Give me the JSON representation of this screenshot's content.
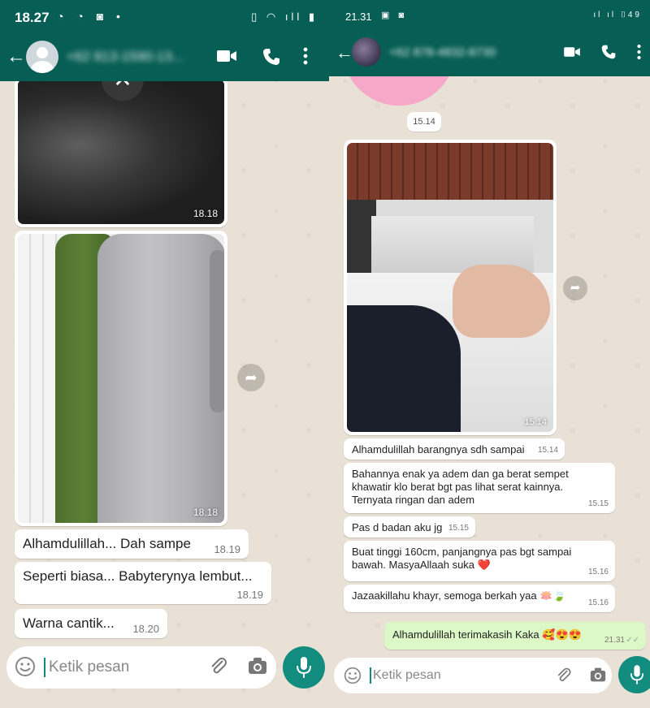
{
  "left": {
    "status_bar": {
      "time": "18.27",
      "notif_icons": [
        "messenger-icon",
        "messenger-icon",
        "instagram-icon",
        "dot"
      ]
    },
    "header": {
      "contact": "+62 813-1590-13..."
    },
    "messages": [
      {
        "type": "image",
        "time": "18.18"
      },
      {
        "type": "image",
        "time": "18.18"
      },
      {
        "type": "text",
        "text": "Alhamdulillah... Dah sampe",
        "time": "18.19"
      },
      {
        "type": "text",
        "text": "Seperti biasa... Babyterynya lembut...",
        "time": "18.19"
      },
      {
        "type": "text",
        "text": "Warna cantik...",
        "time": "18.20"
      }
    ],
    "input": {
      "placeholder": "Ketik pesan"
    }
  },
  "right": {
    "status_bar": {
      "time": "21.31",
      "battery": "49"
    },
    "header": {
      "contact": "+62 878-4832-8730"
    },
    "date_chip": "15.14",
    "image": {
      "time": "15.14"
    },
    "messages": [
      {
        "text": "Alhamdulillah barangnya sdh sampai",
        "time": "15.14"
      },
      {
        "text": "Bahannya enak ya adem dan ga berat  sempet khawatir klo berat bgt pas lihat serat kainnya. Ternyata ringan dan adem",
        "time": "15.15"
      },
      {
        "text": "Pas d badan aku jg",
        "time": "15.15"
      },
      {
        "text": "Buat tinggi 160cm, panjangnya pas bgt sampai bawah. MasyaAllaah suka ❤️",
        "time": "15.16"
      },
      {
        "text": "Jazaakillahu khayr, semoga berkah yaa 🪷🍃",
        "time": "15.16"
      }
    ],
    "outgoing": {
      "text": "Alhamdulillah terimakasih Kaka 🥰😍😍",
      "time": "21.31"
    },
    "input": {
      "placeholder": "Ketik pesan"
    }
  },
  "colors": {
    "header": "#075e54",
    "accent": "#128c7e",
    "outgoing_bubble": "#dcf8c6"
  }
}
